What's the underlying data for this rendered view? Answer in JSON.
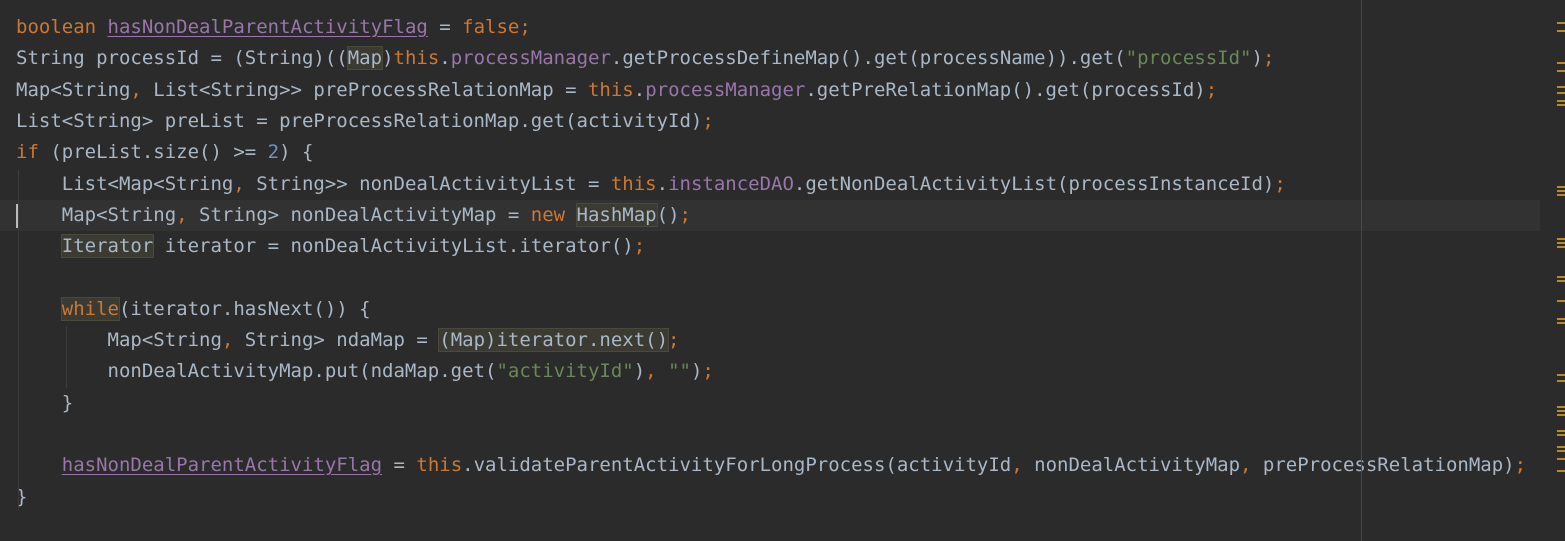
{
  "editor": {
    "lines": [
      [
        {
          "t": "boolean",
          "c": "kw"
        },
        {
          "t": " "
        },
        {
          "t": "hasNonDealParentActivityFlag",
          "c": "ul fld"
        },
        {
          "t": " = "
        },
        {
          "t": "false",
          "c": "kw"
        },
        {
          "t": ";",
          "c": "kw"
        }
      ],
      [
        {
          "t": "String processId = (String)(("
        },
        {
          "t": "Map",
          "c": "hl"
        },
        {
          "t": ")"
        },
        {
          "t": "this",
          "c": "kw"
        },
        {
          "t": "."
        },
        {
          "t": "processManager",
          "c": "fld"
        },
        {
          "t": ".getProcessDefineMap().get(processName)).get("
        },
        {
          "t": "\"processId\"",
          "c": "str"
        },
        {
          "t": ")"
        },
        {
          "t": ";",
          "c": "kw"
        }
      ],
      [
        {
          "t": "Map<String"
        },
        {
          "t": ", ",
          "c": "kw"
        },
        {
          "t": "List<String>> preProcessRelationMap = "
        },
        {
          "t": "this",
          "c": "kw"
        },
        {
          "t": "."
        },
        {
          "t": "processManager",
          "c": "fld"
        },
        {
          "t": ".getPreRelationMap().get(processId)"
        },
        {
          "t": ";",
          "c": "kw"
        }
      ],
      [
        {
          "t": "List<String> preList = preProcessRelationMap.get(activityId)"
        },
        {
          "t": ";",
          "c": "kw"
        }
      ],
      [
        {
          "t": "if",
          "c": "kw"
        },
        {
          "t": " (preList.size() >= "
        },
        {
          "t": "2",
          "c": "num"
        },
        {
          "t": ") {"
        }
      ],
      [
        {
          "t": "    List<Map<String"
        },
        {
          "t": ", ",
          "c": "kw"
        },
        {
          "t": "String>> nonDealActivityList = "
        },
        {
          "t": "this",
          "c": "kw"
        },
        {
          "t": "."
        },
        {
          "t": "instanceDAO",
          "c": "fld"
        },
        {
          "t": ".getNonDealActivityList(processInstanceId)"
        },
        {
          "t": ";",
          "c": "kw"
        }
      ],
      [
        {
          "t": "    Map<String"
        },
        {
          "t": ", ",
          "c": "kw"
        },
        {
          "t": "String> nonDealActivityMap = "
        },
        {
          "t": "new ",
          "c": "kw"
        },
        {
          "t": "HashMap",
          "c": "hl"
        },
        {
          "t": "()"
        },
        {
          "t": ";",
          "c": "kw"
        }
      ],
      [
        {
          "t": "    "
        },
        {
          "t": "Iterator",
          "c": "hl"
        },
        {
          "t": " iterator = nonDealActivityList.iterator()"
        },
        {
          "t": ";",
          "c": "kw"
        }
      ],
      [],
      [
        {
          "t": "    "
        },
        {
          "t": "while",
          "c": "kw hl"
        },
        {
          "t": "(iterator.hasNext()) {"
        }
      ],
      [
        {
          "t": "        Map<String"
        },
        {
          "t": ", ",
          "c": "kw"
        },
        {
          "t": "String> ndaMap = "
        },
        {
          "t": "(Map)iterator.next()",
          "c": "hl"
        },
        {
          "t": ";",
          "c": "kw"
        }
      ],
      [
        {
          "t": "        nonDealActivityMap.put(ndaMap.get("
        },
        {
          "t": "\"activityId\"",
          "c": "str"
        },
        {
          "t": ")"
        },
        {
          "t": ", ",
          "c": "kw"
        },
        {
          "t": "\"\"",
          "c": "str"
        },
        {
          "t": ")"
        },
        {
          "t": ";",
          "c": "kw"
        }
      ],
      [
        {
          "t": "    }"
        }
      ],
      [],
      [
        {
          "t": "    "
        },
        {
          "t": "hasNonDealParentActivityFlag",
          "c": "ul fld"
        },
        {
          "t": " = "
        },
        {
          "t": "this",
          "c": "kw"
        },
        {
          "t": ".validateParentActivityForLongProcess(activityId"
        },
        {
          "t": ", ",
          "c": "kw"
        },
        {
          "t": "nonDealActivityMap"
        },
        {
          "t": ", ",
          "c": "kw"
        },
        {
          "t": "preProcessRelationMap)"
        },
        {
          "t": ";",
          "c": "kw"
        }
      ],
      [
        {
          "t": "}"
        }
      ]
    ],
    "current_line": 6
  },
  "colors": {
    "background": "#2b2b2b",
    "keyword": "#cc7832",
    "field": "#9876aa",
    "string": "#6a8759",
    "number": "#6897bb",
    "default": "#a9b7c6"
  }
}
